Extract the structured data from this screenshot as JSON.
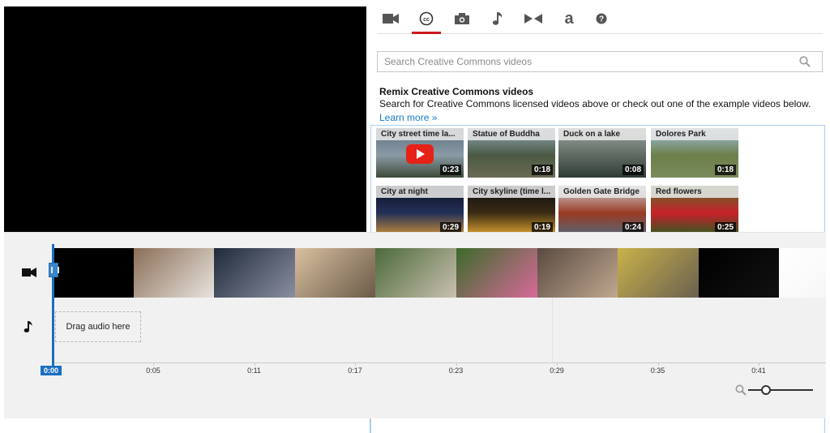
{
  "tabs": [
    {
      "icon": "video-camera-icon",
      "active": false
    },
    {
      "icon": "creative-commons-icon",
      "active": true
    },
    {
      "icon": "photo-camera-icon",
      "active": false
    },
    {
      "icon": "music-note-icon",
      "active": false
    },
    {
      "icon": "transitions-icon",
      "active": false
    },
    {
      "icon": "text-a-icon",
      "active": false
    },
    {
      "icon": "help-icon",
      "active": false
    }
  ],
  "search": {
    "placeholder": "Search Creative Commons videos"
  },
  "intro": {
    "title": "Remix Creative Commons videos",
    "description": "Search for Creative Commons licensed videos above or check out one of the example videos below.",
    "learn_more": "Learn more »"
  },
  "videos": [
    {
      "title": "City street time la...",
      "duration": "0:23",
      "colors": [
        "#5d6f7f",
        "#8a9aa6",
        "#3d4a38"
      ],
      "play": true
    },
    {
      "title": "Statue of Buddha",
      "duration": "0:18",
      "colors": [
        "#8fa6b8",
        "#4b5a44",
        "#6b6a52"
      ],
      "play": false
    },
    {
      "title": "Duck on a lake",
      "duration": "0:08",
      "colors": [
        "#9aa5a0",
        "#5f6b62",
        "#2e3a35"
      ],
      "play": false
    },
    {
      "title": "Dolores Park",
      "duration": "0:18",
      "colors": [
        "#9ec2e0",
        "#6d7f4a",
        "#7a8a5b"
      ],
      "play": false
    },
    {
      "title": "City at night",
      "duration": "0:29",
      "colors": [
        "#0a0e1e",
        "#233058",
        "#c08a3a"
      ],
      "play": false
    },
    {
      "title": "City skyline (time l...",
      "duration": "0:19",
      "colors": [
        "#0b0b10",
        "#3a2b14",
        "#d9a030"
      ],
      "play": false
    },
    {
      "title": "Golden Gate Bridge",
      "duration": "0:24",
      "colors": [
        "#cfd9e2",
        "#9a3a22",
        "#566574"
      ],
      "play": false
    },
    {
      "title": "Red flowers",
      "duration": "0:25",
      "colors": [
        "#4a7a2a",
        "#c9202a",
        "#2f5a1e"
      ],
      "play": false
    }
  ],
  "timeline": {
    "audio_placeholder": "Drag audio here",
    "playhead_time": "0:00",
    "ticks": [
      "0:05",
      "0:11",
      "0:17",
      "0:23",
      "0:29",
      "0:35",
      "0:41"
    ],
    "frames": [
      {
        "colors": [
          "#000000",
          "#000000"
        ]
      },
      {
        "colors": [
          "#8b6e58",
          "#e8e4de"
        ]
      },
      {
        "colors": [
          "#1f2a3a",
          "#8a8fa0"
        ]
      },
      {
        "colors": [
          "#d9c0a0",
          "#6a5a48"
        ]
      },
      {
        "colors": [
          "#4c6a3a",
          "#c9c0b0"
        ]
      },
      {
        "colors": [
          "#3c6a2a",
          "#d86a9a"
        ]
      },
      {
        "colors": [
          "#5a4a40",
          "#c0a890"
        ]
      },
      {
        "colors": [
          "#c9b24a",
          "#6a6050"
        ]
      },
      {
        "colors": [
          "#000000",
          "#111111"
        ]
      },
      {
        "colors": [
          "#ffffff",
          "#f4f4f4"
        ]
      }
    ]
  }
}
